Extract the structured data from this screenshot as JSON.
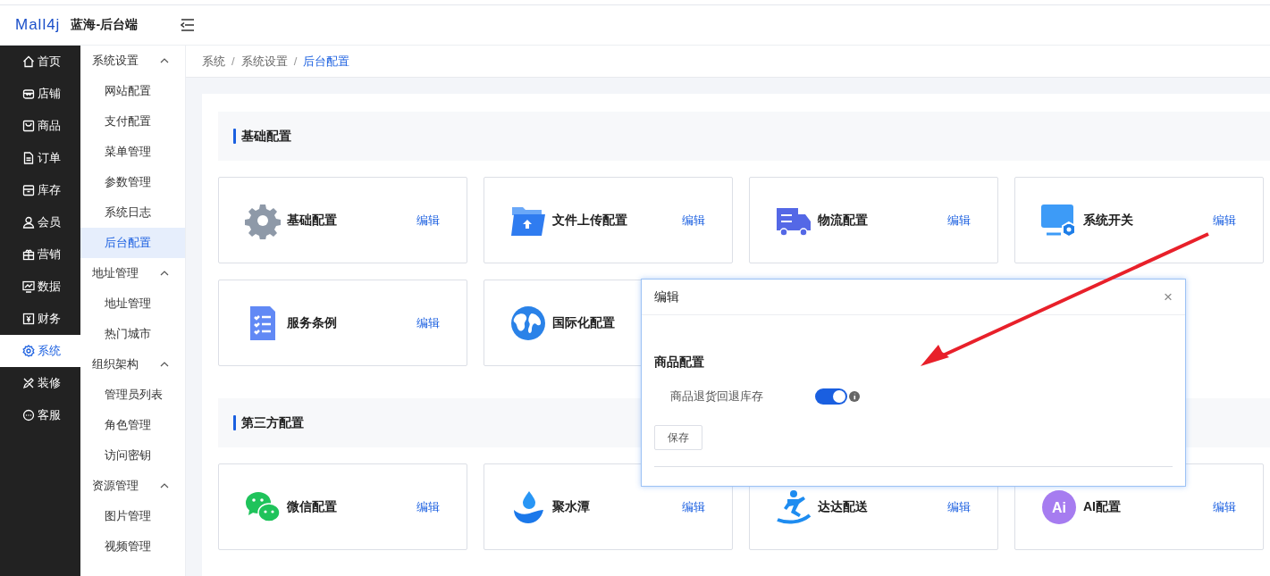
{
  "header": {
    "logo": "Mall4j",
    "title": "蓝海-后台端"
  },
  "sidebar": {
    "items": [
      {
        "label": "首页",
        "selected": false
      },
      {
        "label": "店铺",
        "selected": false
      },
      {
        "label": "商品",
        "selected": false
      },
      {
        "label": "订单",
        "selected": false
      },
      {
        "label": "库存",
        "selected": false
      },
      {
        "label": "会员",
        "selected": false
      },
      {
        "label": "营销",
        "selected": false
      },
      {
        "label": "数据",
        "selected": false
      },
      {
        "label": "财务",
        "selected": false
      },
      {
        "label": "系统",
        "selected": true
      },
      {
        "label": "装修",
        "selected": false
      },
      {
        "label": "客服",
        "selected": false
      }
    ]
  },
  "submenu": [
    {
      "label": "系统设置",
      "expanded": true,
      "children": [
        {
          "label": "网站配置",
          "selected": false
        },
        {
          "label": "支付配置",
          "selected": false
        },
        {
          "label": "菜单管理",
          "selected": false
        },
        {
          "label": "参数管理",
          "selected": false
        },
        {
          "label": "系统日志",
          "selected": false
        },
        {
          "label": "后台配置",
          "selected": true
        }
      ]
    },
    {
      "label": "地址管理",
      "expanded": true,
      "children": [
        {
          "label": "地址管理",
          "selected": false
        },
        {
          "label": "热门城市",
          "selected": false
        }
      ]
    },
    {
      "label": "组织架构",
      "expanded": true,
      "children": [
        {
          "label": "管理员列表",
          "selected": false
        },
        {
          "label": "角色管理",
          "selected": false
        },
        {
          "label": "访问密钥",
          "selected": false
        }
      ]
    },
    {
      "label": "资源管理",
      "expanded": true,
      "children": [
        {
          "label": "图片管理",
          "selected": false
        },
        {
          "label": "视频管理",
          "selected": false
        }
      ]
    }
  ],
  "breadcrumb": [
    {
      "text": "系统",
      "kind": "link"
    },
    {
      "text": "/",
      "kind": "separator"
    },
    {
      "text": "系统设置",
      "kind": "link"
    },
    {
      "text": "/",
      "kind": "separator"
    },
    {
      "text": "后台配置",
      "kind": "current"
    }
  ],
  "sections": [
    {
      "title": "基础配置",
      "cards": [
        {
          "title": "基础配置",
          "edit": "编辑"
        },
        {
          "title": "文件上传配置",
          "edit": "编辑"
        },
        {
          "title": "物流配置",
          "edit": "编辑"
        },
        {
          "title": "系统开关",
          "edit": "编辑"
        },
        {
          "title": "服务条例",
          "edit": "编辑"
        },
        {
          "title": "国际化配置"
        }
      ]
    },
    {
      "title": "第三方配置",
      "cards": [
        {
          "title": "微信配置",
          "edit": "编辑"
        },
        {
          "title": "聚水潭",
          "edit": "编辑"
        },
        {
          "title": "达达配送",
          "edit": "编辑"
        },
        {
          "title": "AI配置",
          "icon_text": "Ai",
          "edit": "编辑"
        }
      ]
    }
  ],
  "dialog": {
    "title": "编辑",
    "close": "×",
    "section": "商品配置",
    "setting": {
      "label": "商品退货回退库存",
      "on": true
    },
    "save": "保存"
  }
}
